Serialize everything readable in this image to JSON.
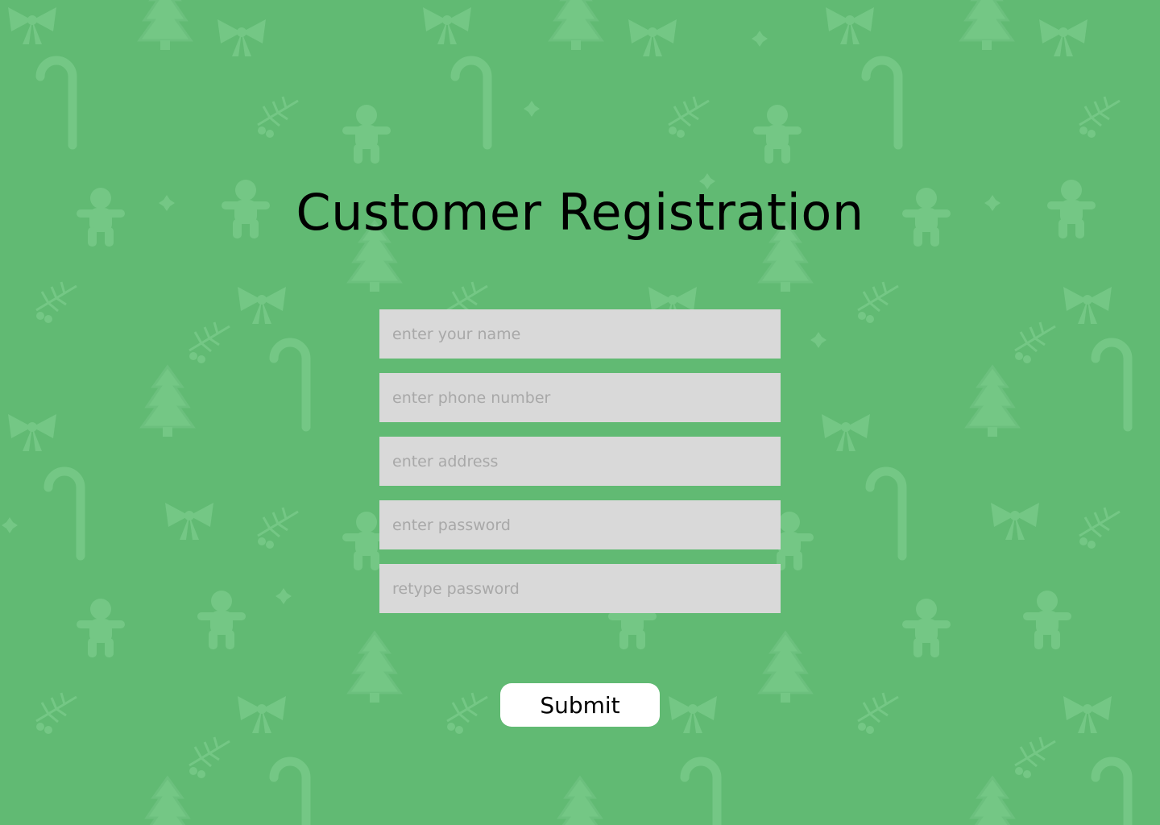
{
  "page": {
    "title": "Customer Registration",
    "background_color": "#61ba73",
    "pattern_color": "#74c785",
    "pattern_icons": [
      "christmas-tree-icon",
      "candy-cane-icon",
      "gingerbread-man-icon",
      "bow-icon",
      "holly-icon",
      "star-icon"
    ]
  },
  "form": {
    "name_placeholder": "enter your name",
    "phone_placeholder": "enter phone number",
    "address_placeholder": "enter address",
    "password_placeholder": "enter password",
    "retype_password_placeholder": "retype password",
    "field_background": "#d9d9d9"
  },
  "actions": {
    "submit_label": "Submit"
  }
}
